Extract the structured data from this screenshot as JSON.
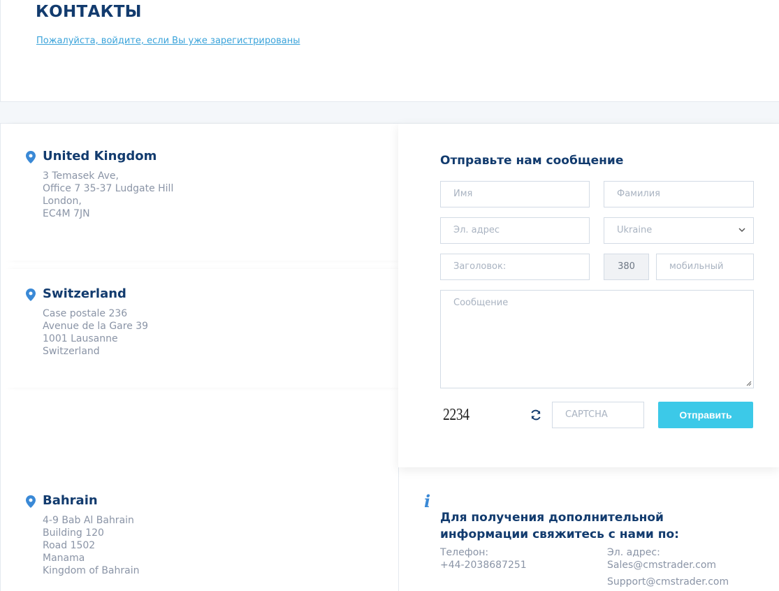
{
  "header": {
    "title": "КОНТАКТЫ",
    "login_link": "Пожалуйста, войдите, если Вы уже зарегистрированы"
  },
  "offices": [
    {
      "country": "United Kingdom",
      "lines": [
        "3 Temasek Ave,",
        "Office 7 35-37 Ludgate Hill",
        "London,",
        "EC4M 7JN"
      ]
    },
    {
      "country": "Switzerland",
      "lines": [
        "Case postale 236",
        "Avenue de la Gare 39",
        "1001 Lausanne",
        "Switzerland"
      ]
    },
    {
      "country": "Bahrain",
      "lines": [
        "4-9 Bab Al Bahrain",
        "Building 120",
        "Road 1502",
        "Manama",
        "Kingdom of Bahrain"
      ]
    }
  ],
  "form": {
    "title": "Отправьте нам сообщение",
    "first_name_placeholder": "Имя",
    "last_name_placeholder": "Фамилия",
    "email_placeholder": "Эл. адрес",
    "country_selected": "Ukraine",
    "subject_placeholder": "Заголовок:",
    "phone_code": "380",
    "mobile_placeholder": "мобильный",
    "message_placeholder": "Сообщение",
    "captcha_text": "2234",
    "captcha_placeholder": "CAPTCHA",
    "submit_label": "Отправить"
  },
  "info": {
    "title": "Для получения дополнительной информации свяжитесь с нами по:",
    "phone_label": "Телефон:",
    "phone_value": "+44-2038687251",
    "email_label": "Эл. адрес:",
    "email_sales": "Sales@cmstrader.com",
    "email_support": "Support@cmstrader.com"
  },
  "colors": {
    "accent": "#3cc9e8",
    "heading": "#123b6e",
    "pin": "#3a89d6",
    "link": "#3aa3da"
  }
}
